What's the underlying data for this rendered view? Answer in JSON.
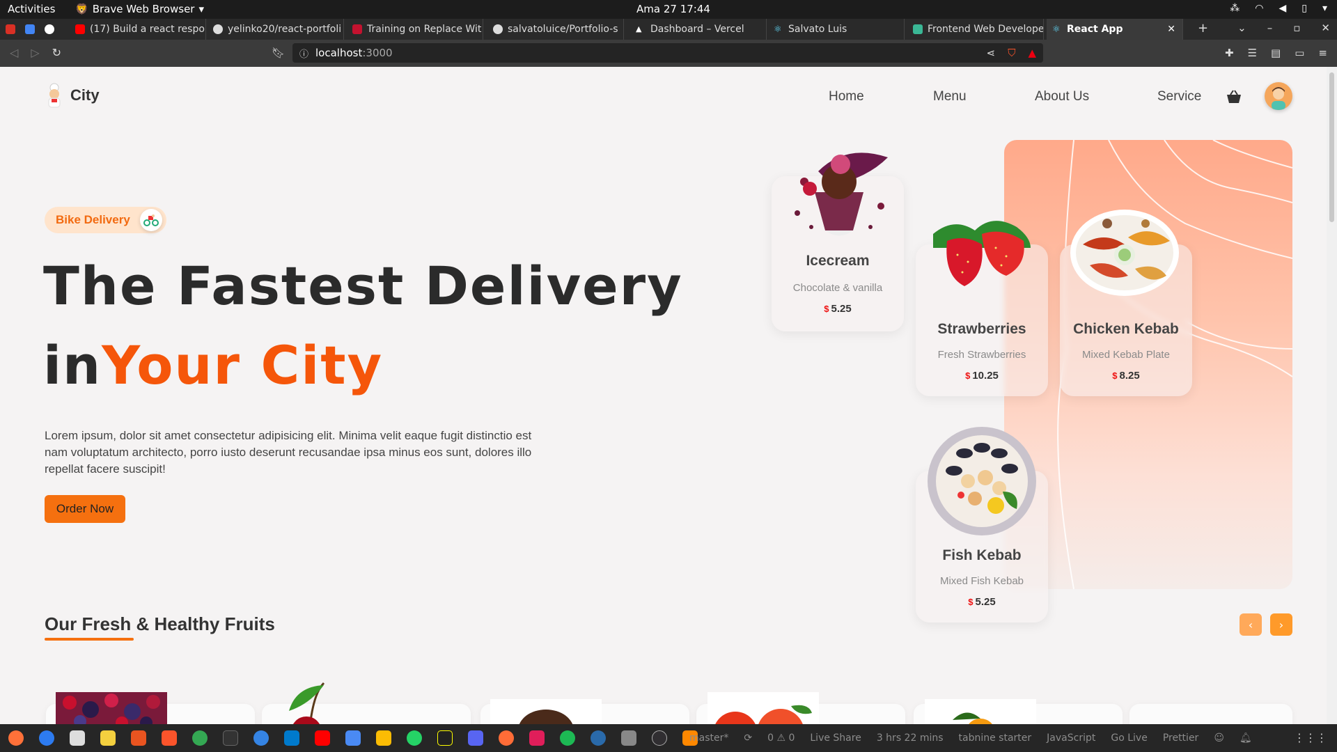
{
  "system": {
    "activities": "Activities",
    "browser_name": "Brave Web Browser",
    "clock": "Ama 27  17:44"
  },
  "tabs": [
    {
      "label": "(17) Build a react respon",
      "favicon_color": "#ff0000"
    },
    {
      "label": "yelinko20/react-portfoli",
      "favicon_color": "#dddddd"
    },
    {
      "label": "Training on Replace Wit",
      "favicon_color": "#c4122f"
    },
    {
      "label": "salvatoluice/Portfolio-s",
      "favicon_color": "#dddddd"
    },
    {
      "label": "Dashboard – Vercel",
      "favicon_color": "#ffffff"
    },
    {
      "label": "Salvato Luis",
      "favicon_color": "#61dafb"
    },
    {
      "label": "Frontend Web Develope",
      "favicon_color": "#3ab795"
    },
    {
      "label": "React App",
      "favicon_color": "#61dafb",
      "active": true
    }
  ],
  "address": {
    "host": "localhost",
    "port": ":3000"
  },
  "site": {
    "logo_name": "City",
    "nav": [
      "Home",
      "Menu",
      "About Us",
      "Service"
    ],
    "badge": "Bike Delivery",
    "headline_1": "The Fastest Delivery",
    "headline_2a": "in",
    "headline_2b": "Your City",
    "description": "Lorem ipsum, dolor sit amet consectetur adipisicing elit. Minima velit eaque fugit distinctio est nam voluptatum architecto, porro iusto deserunt recusandae ipsa minus eos sunt, dolores illo repellat facere suscipit!",
    "order_button": "Order Now",
    "section_title": "Our Fresh & Healthy Fruits",
    "accent_color": "#f5560a"
  },
  "cards": [
    {
      "title": "Icecream",
      "subtitle": "Chocolate & vanilla",
      "currency": "$",
      "price": "5.25"
    },
    {
      "title": "Strawberries",
      "subtitle": "Fresh Strawberries",
      "currency": "$",
      "price": "10.25"
    },
    {
      "title": "Chicken Kebab",
      "subtitle": "Mixed Kebab Plate",
      "currency": "$",
      "price": "8.25"
    },
    {
      "title": "Fish Kebab",
      "subtitle": "Mixed Fish Kebab",
      "currency": "$",
      "price": "5.25"
    }
  ],
  "taskbar": {
    "status_items": [
      "master*",
      "0 ⚠ 0",
      "Live Share",
      "3 hrs 22 mins",
      "tabnine starter",
      "JavaScript",
      "Go Live",
      "Prettier"
    ]
  }
}
